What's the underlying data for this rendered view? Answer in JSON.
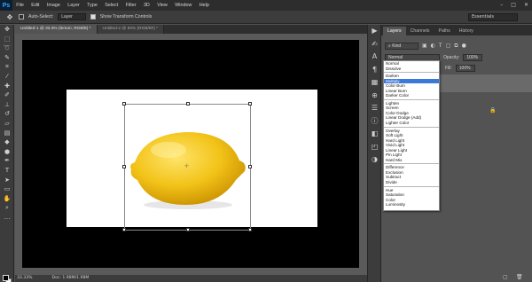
{
  "app": {
    "logo": "Ps"
  },
  "menubar": {
    "items": [
      "File",
      "Edit",
      "Image",
      "Layer",
      "Type",
      "Select",
      "Filter",
      "3D",
      "View",
      "Window",
      "Help"
    ]
  },
  "options": {
    "auto_select_label": "Auto-Select:",
    "auto_select_value": "Layer",
    "show_transform_label": "Show Transform Controls",
    "workspace": "Essentials"
  },
  "tabs": [
    {
      "label": "Untitled-1 @ 33.3% (lemon, RGB/8) *"
    },
    {
      "label": "Untitled-2 @ 50% (RGB/8#) *"
    }
  ],
  "status": {
    "zoom": "33.33%",
    "doc": "Doc: 1.98M/1.98M"
  },
  "panel": {
    "tabs": [
      "Layers",
      "Channels",
      "Paths",
      "History"
    ],
    "kind_label": "Kind",
    "blend_mode": "Normal",
    "opacity_label": "Opacity:",
    "opacity_value": "100%",
    "fill_label": "Fill:",
    "fill_value": "100%"
  },
  "blend_modes": [
    [
      "Normal",
      "Dissolve"
    ],
    [
      "Darken",
      "Multiply",
      "Color Burn",
      "Linear Burn",
      "Darker Color"
    ],
    [
      "Lighten",
      "Screen",
      "Color Dodge",
      "Linear Dodge (Add)",
      "Lighter Color"
    ],
    [
      "Overlay",
      "Soft Light",
      "Hard Light",
      "Vivid Light",
      "Linear Light",
      "Pin Light",
      "Hard Mix"
    ],
    [
      "Difference",
      "Exclusion",
      "Subtract",
      "Divide"
    ],
    [
      "Hue",
      "Saturation",
      "Color",
      "Luminosity"
    ]
  ],
  "selected_blend": "Multiply",
  "colors": {
    "lemon": "#f2c318",
    "highlight": "#3c78d8",
    "foreground": "#000000",
    "background": "#ffffff"
  }
}
